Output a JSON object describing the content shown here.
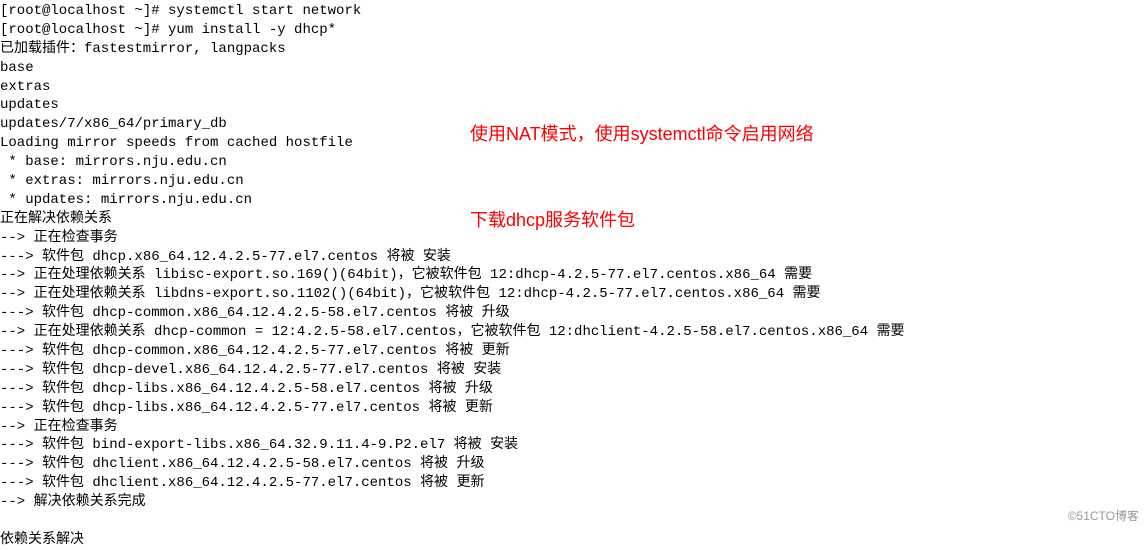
{
  "terminal": {
    "lines": [
      "[root@localhost ~]# systemctl start network",
      "[root@localhost ~]# yum install -y dhcp*",
      "已加载插件：fastestmirror, langpacks",
      "base",
      "extras",
      "updates",
      "updates/7/x86_64/primary_db",
      "Loading mirror speeds from cached hostfile",
      " * base: mirrors.nju.edu.cn",
      " * extras: mirrors.nju.edu.cn",
      " * updates: mirrors.nju.edu.cn",
      "正在解决依赖关系",
      "--> 正在检查事务",
      "---> 软件包 dhcp.x86_64.12.4.2.5-77.el7.centos 将被 安装",
      "--> 正在处理依赖关系 libisc-export.so.169()(64bit)，它被软件包 12:dhcp-4.2.5-77.el7.centos.x86_64 需要",
      "--> 正在处理依赖关系 libdns-export.so.1102()(64bit)，它被软件包 12:dhcp-4.2.5-77.el7.centos.x86_64 需要",
      "---> 软件包 dhcp-common.x86_64.12.4.2.5-58.el7.centos 将被 升级",
      "--> 正在处理依赖关系 dhcp-common = 12:4.2.5-58.el7.centos，它被软件包 12:dhclient-4.2.5-58.el7.centos.x86_64 需要",
      "---> 软件包 dhcp-common.x86_64.12.4.2.5-77.el7.centos 将被 更新",
      "---> 软件包 dhcp-devel.x86_64.12.4.2.5-77.el7.centos 将被 安装",
      "---> 软件包 dhcp-libs.x86_64.12.4.2.5-58.el7.centos 将被 升级",
      "---> 软件包 dhcp-libs.x86_64.12.4.2.5-77.el7.centos 将被 更新",
      "--> 正在检查事务",
      "---> 软件包 bind-export-libs.x86_64.32.9.11.4-9.P2.el7 将被 安装",
      "---> 软件包 dhclient.x86_64.12.4.2.5-58.el7.centos 将被 升级",
      "---> 软件包 dhclient.x86_64.12.4.2.5-77.el7.centos 将被 更新",
      "--> 解决依赖关系完成",
      "",
      "依赖关系解决"
    ]
  },
  "annotation": {
    "line1": "使用NAT模式，使用systemctl命令启用网络",
    "line2": "下载dhcp服务软件包"
  },
  "watermark": {
    "text": "©51CTO博客"
  }
}
